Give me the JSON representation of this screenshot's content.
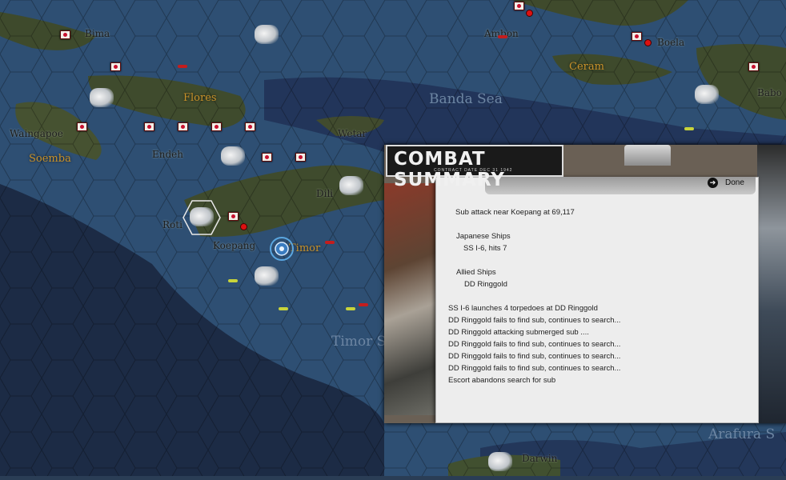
{
  "map": {
    "places": [
      {
        "name": "Bima"
      },
      {
        "name": "Ambon"
      },
      {
        "name": "Boela"
      },
      {
        "name": "Babo"
      },
      {
        "name": "Waingapoe"
      },
      {
        "name": "Endeh"
      },
      {
        "name": "Wetar"
      },
      {
        "name": "Dili"
      },
      {
        "name": "Roti"
      },
      {
        "name": "Koepang"
      },
      {
        "name": "Darwin"
      }
    ],
    "regions": [
      {
        "name": "Soemba"
      },
      {
        "name": "Flores"
      },
      {
        "name": "Ceram"
      },
      {
        "name": "Timor"
      }
    ],
    "seas": [
      {
        "name": "Banda Sea"
      },
      {
        "name": "Timor S"
      },
      {
        "name": "Arafura S"
      }
    ],
    "colors": {
      "ocean_shallow": "#2e4f73",
      "ocean_deep": "#1c2b45",
      "land": "#3e4a2c",
      "jp_flag": "#c8102e"
    }
  },
  "summary": {
    "title": "COMBAT SUMMARY",
    "subtitle": "CONTRACT DATE  DEC 31 1942",
    "done_label": "Done",
    "done_icon": "arrow-circle-icon",
    "lines": [
      "Sub attack near Koepang at 69,117",
      "Japanese Ships",
      "SS I-6, hits 7",
      "Allied Ships",
      "DD Ringgold",
      "SS I-6 launches 4 torpedoes at DD Ringgold",
      "DD Ringgold fails to find sub, continues to search...",
      "DD Ringgold attacking submerged sub ....",
      "DD Ringgold fails to find sub, continues to search...",
      "DD Ringgold fails to find sub, continues to search...",
      "DD Ringgold fails to find sub, continues to search...",
      "Escort abandons search for sub"
    ]
  }
}
